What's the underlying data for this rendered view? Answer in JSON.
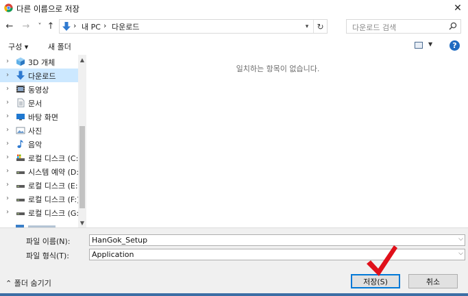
{
  "window": {
    "title": "다른 이름으로 저장",
    "close_label": "✕"
  },
  "navigation": {
    "back_label": "←",
    "forward_label": "→",
    "recent_label": "˅",
    "up_label": "↑",
    "address": {
      "separator1": "›",
      "segment1": "내 PC",
      "separator2": "›",
      "segment2": "다운로드"
    },
    "search_placeholder": "다운로드 검색"
  },
  "toolbar": {
    "organize_label": "구성 ▾",
    "new_folder_label": "새 폴더",
    "help_label": "?"
  },
  "sidebar": {
    "items": [
      {
        "label": "3D 개체",
        "icon": "3d-objects-icon"
      },
      {
        "label": "다운로드",
        "icon": "download-icon",
        "selected": true
      },
      {
        "label": "동영상",
        "icon": "video-icon"
      },
      {
        "label": "문서",
        "icon": "document-icon"
      },
      {
        "label": "바탕 화면",
        "icon": "desktop-icon"
      },
      {
        "label": "사진",
        "icon": "pictures-icon"
      },
      {
        "label": "음악",
        "icon": "music-icon"
      },
      {
        "label": "로컬 디스크 (C:)",
        "icon": "system-drive-icon"
      },
      {
        "label": "시스템 예약 (D:)",
        "icon": "drive-icon"
      },
      {
        "label": "로컬 디스크 (E:)",
        "icon": "drive-icon"
      },
      {
        "label": "로컬 디스크 (F:)",
        "icon": "drive-icon"
      },
      {
        "label": "로컬 디스크 (G:)",
        "icon": "drive-icon"
      }
    ]
  },
  "content": {
    "empty_message": "일치하는 항목이 없습니다."
  },
  "fields": {
    "filename_label": "파일 이름(N):",
    "filename_value": "HanGok_Setup",
    "filetype_label": "파일 형식(T):",
    "filetype_value": "Application"
  },
  "footer": {
    "hide_folders_label": "⌃ 폴더 숨기기",
    "save_label": "저장(S)",
    "cancel_label": "취소"
  },
  "colors": {
    "accent": "#0078d7",
    "selected_bg": "#cce8ff",
    "checkmark": "#e0101a",
    "panel_bg": "#f0f0f0"
  }
}
